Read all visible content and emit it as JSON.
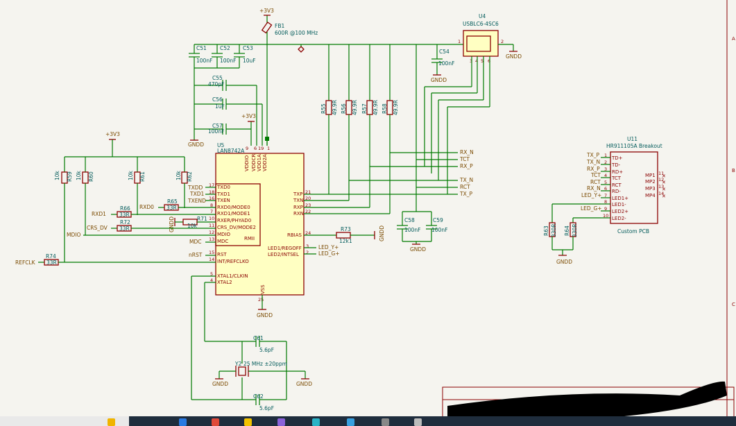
{
  "power": {
    "vcc": "+3V3",
    "gnd": "GNDD"
  },
  "fb1": {
    "ref": "FB1",
    "value": "600R @100 MHz"
  },
  "u4": {
    "ref": "U4",
    "value": "USBLC6-4SC6",
    "pins": [
      "1",
      "2",
      "3",
      "4",
      "5",
      "6"
    ]
  },
  "u5": {
    "ref": "U5",
    "value": "LAN8742A",
    "left_pins": [
      {
        "num": "17",
        "name": "TXD0"
      },
      {
        "num": "18",
        "name": "TXD1"
      },
      {
        "num": "16",
        "name": "TXEN"
      },
      {
        "num": "8",
        "name": "RXD0/MODE0"
      },
      {
        "num": "7",
        "name": "RXD1/MODE1"
      },
      {
        "num": "10",
        "name": "RXER/PHYAD0"
      },
      {
        "num": "11",
        "name": "CRS_DV/MODE2"
      },
      {
        "num": "12",
        "name": "MDIO"
      },
      {
        "num": "13",
        "name": "MDC"
      },
      {
        "num": "15",
        "name": "RST"
      },
      {
        "num": "14",
        "name": "INT/REFCLKO"
      },
      {
        "num": "5",
        "name": "XTAL1/CLKIN"
      },
      {
        "num": "4",
        "name": "XTAL2"
      }
    ],
    "right_pins": [
      {
        "num": "21",
        "name": "TXP"
      },
      {
        "num": "20",
        "name": "TXN"
      },
      {
        "num": "23",
        "name": "RXP"
      },
      {
        "num": "22",
        "name": "RXN"
      },
      {
        "num": "24",
        "name": "RBIAS"
      },
      {
        "num": "3",
        "name": "LED1/REGOFF"
      },
      {
        "num": "2",
        "name": "LED2/INTSEL"
      }
    ],
    "top_pins": [
      {
        "num": "9",
        "name": "VDDIO"
      },
      {
        "num": "6",
        "name": "VDDCR"
      },
      {
        "num": "19",
        "name": "VDD1A"
      },
      {
        "num": "1",
        "name": "VDD2A"
      }
    ],
    "bottom_pin": {
      "num": "25",
      "name": "VSS"
    },
    "rmii": "RMII"
  },
  "caps": [
    {
      "ref": "C51",
      "value": "100nF"
    },
    {
      "ref": "C52",
      "value": "100nF"
    },
    {
      "ref": "C53",
      "value": "10uF"
    },
    {
      "ref": "C55",
      "value": "470pF"
    },
    {
      "ref": "C56",
      "value": "1uF"
    },
    {
      "ref": "C57",
      "value": "100nF"
    },
    {
      "ref": "C54",
      "value": "100nF"
    },
    {
      "ref": "C58",
      "value": "100nF"
    },
    {
      "ref": "C59",
      "value": "100nF"
    },
    {
      "ref": "C61",
      "value": "5.6pF"
    },
    {
      "ref": "C62",
      "value": "5.6pF"
    }
  ],
  "resistors": [
    {
      "ref": "R55",
      "value": "49.9R"
    },
    {
      "ref": "R56",
      "value": "49.9R"
    },
    {
      "ref": "R57",
      "value": "49.9R"
    },
    {
      "ref": "R58",
      "value": "49.9R"
    },
    {
      "ref": "R59",
      "value": "10k"
    },
    {
      "ref": "R60",
      "value": "10k"
    },
    {
      "ref": "R61",
      "value": "10k"
    },
    {
      "ref": "R62",
      "value": "10k"
    },
    {
      "ref": "R65",
      "value": "33R"
    },
    {
      "ref": "R66",
      "value": "33R"
    },
    {
      "ref": "R71",
      "value": "10k"
    },
    {
      "ref": "R72",
      "value": "33R"
    },
    {
      "ref": "R73",
      "value": "12k1"
    },
    {
      "ref": "R74",
      "value": "33R"
    },
    {
      "ref": "R63",
      "value": "330R"
    },
    {
      "ref": "R64",
      "value": "330R"
    }
  ],
  "crystal": {
    "ref": "Y2",
    "value": "25 MHz ±20ppm"
  },
  "u11": {
    "ref": "U11",
    "value": "HR911105A Breakout",
    "footer": "Custom PCB",
    "pins": [
      {
        "num": "1",
        "name": "TD+",
        "net": "TX_P"
      },
      {
        "num": "2",
        "name": "TD-",
        "net": "TX_N"
      },
      {
        "num": "3",
        "name": "RD+",
        "net": "RX_P"
      },
      {
        "num": "4",
        "name": "TCT",
        "net": "TCT"
      },
      {
        "num": "5",
        "name": "RCT",
        "net": "RCT"
      },
      {
        "num": "6",
        "name": "RD-",
        "net": "RX_N"
      },
      {
        "num": "7",
        "name": "LED1+",
        "net": "LED_Y+"
      },
      {
        "num": "8",
        "name": "LED1-",
        "net": ""
      },
      {
        "num": "9",
        "name": "LED2+",
        "net": "LED_G+"
      },
      {
        "num": "10",
        "name": "LED2-",
        "net": ""
      }
    ],
    "mp": [
      {
        "num": "11",
        "name": "MP1"
      },
      {
        "num": "12",
        "name": "MP2"
      },
      {
        "num": "13",
        "name": "MP3"
      },
      {
        "num": "14",
        "name": "MP4"
      }
    ]
  },
  "net_labels": {
    "txdd": "TXDD",
    "txd1": "TXD1",
    "txend": "TXEND",
    "rxd0": "RXD0",
    "rxd1": "RXD1",
    "crs_dv": "CRS_DV",
    "mdio": "MDIO",
    "mdc": "MDC",
    "nrst": "nRST",
    "refclk": "REFCLK",
    "rx_n": "RX_N",
    "tct": "TCT",
    "rx_p": "RX_P",
    "tx_n": "TX_N",
    "rct": "RCT",
    "tx_p": "TX_P",
    "led_y": "LED_Y+",
    "led_g": "LED_G+"
  },
  "border": {
    "a": "A",
    "b": "B",
    "c": "C"
  }
}
